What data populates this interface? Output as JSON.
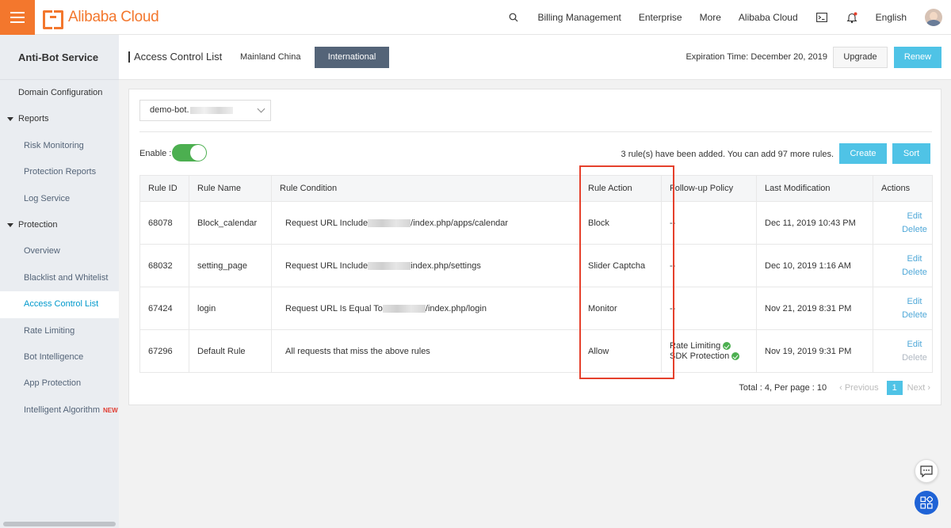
{
  "topbar": {
    "brand": "Alibaba Cloud",
    "nav": [
      "Billing Management",
      "Enterprise",
      "More",
      "Alibaba Cloud"
    ],
    "language": "English"
  },
  "sidebar": {
    "title": "Anti-Bot Service",
    "items": [
      {
        "label": "Domain Configuration",
        "level": 1
      },
      {
        "label": "Reports",
        "level": 0
      },
      {
        "label": "Risk Monitoring",
        "level": 2
      },
      {
        "label": "Protection Reports",
        "level": 2
      },
      {
        "label": "Log Service",
        "level": 2
      },
      {
        "label": "Protection",
        "level": 0
      },
      {
        "label": "Overview",
        "level": 2
      },
      {
        "label": "Blacklist and Whitelist",
        "level": 2
      },
      {
        "label": "Access Control List",
        "level": 2,
        "active": true
      },
      {
        "label": "Rate Limiting",
        "level": 2
      },
      {
        "label": "Bot Intelligence",
        "level": 2
      },
      {
        "label": "App Protection",
        "level": 2
      },
      {
        "label": "Intelligent Algorithm",
        "level": 2,
        "badge": "NEW"
      }
    ]
  },
  "header": {
    "title": "Access Control List",
    "tabs": [
      "Mainland China",
      "International"
    ],
    "selected_tab": "International",
    "expiration": "Expiration Time: December 20, 2019",
    "upgrade_label": "Upgrade",
    "renew_label": "Renew"
  },
  "toolbar": {
    "domain_prefix": "demo-bot.",
    "enable_label": "Enable :",
    "enabled": true,
    "rule_count_text": "3 rule(s) have been added. You can add 97 more rules.",
    "create_label": "Create",
    "sort_label": "Sort"
  },
  "table": {
    "columns": [
      "Rule ID",
      "Rule Name",
      "Rule Condition",
      "Rule Action",
      "Follow-up Policy",
      "Last Modification",
      "Actions"
    ],
    "rows": [
      {
        "id": "68078",
        "name": "Block_calendar",
        "cond_pre": "Request URL Include",
        "cond_post": "/index.php/apps/calendar",
        "action": "Block",
        "policy": [
          "--"
        ],
        "modified": "Dec 11, 2019 10:43 PM",
        "edit": "Edit",
        "delete": "Delete"
      },
      {
        "id": "68032",
        "name": "setting_page",
        "cond_pre": "Request URL Include",
        "cond_post": "index.php/settings",
        "action": "Slider Captcha",
        "policy": [
          "--"
        ],
        "modified": "Dec 10, 2019 1:16 AM",
        "edit": "Edit",
        "delete": "Delete"
      },
      {
        "id": "67424",
        "name": "login",
        "cond_pre": "Request URL Is Equal To",
        "cond_post": "/index.php/login",
        "action": "Monitor",
        "policy": [
          "--"
        ],
        "modified": "Nov 21, 2019 8:31 PM",
        "edit": "Edit",
        "delete": "Delete"
      },
      {
        "id": "67296",
        "name": "Default Rule",
        "cond_pre": "All requests that miss the above rules",
        "cond_post": "",
        "action": "Allow",
        "policy": [
          "Rate Limiting",
          "SDK Protection"
        ],
        "modified": "Nov 19, 2019 9:31 PM",
        "edit": "Edit",
        "delete": "Delete"
      }
    ]
  },
  "pagination": {
    "total_text": "Total : 4, Per page : 10",
    "previous_label": "Previous",
    "current_page": "1",
    "next_label": "Next"
  },
  "colors": {
    "brand": "#f3772d",
    "accent": "#4fc3e6",
    "tab_selected": "#546478",
    "toggle_on": "#4caf50",
    "highlight": "#e5402c"
  }
}
